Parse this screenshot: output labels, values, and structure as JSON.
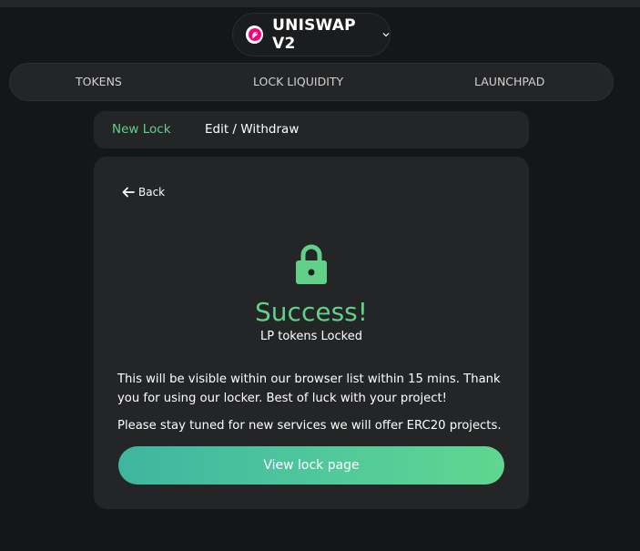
{
  "network": {
    "name": "UNISWAP V2",
    "icon": "uniswap-logo-icon",
    "dropdown_icon": "chevron-down-icon"
  },
  "main_tabs": [
    {
      "label": "TOKENS"
    },
    {
      "label": "LOCK LIQUIDITY"
    },
    {
      "label": "LAUNCHPAD"
    }
  ],
  "sub_tabs": [
    {
      "label": "New Lock",
      "active": true
    },
    {
      "label": "Edit / Withdraw",
      "active": false
    }
  ],
  "card": {
    "back_label": "Back",
    "status_icon": "lock-icon",
    "title": "Success!",
    "subtitle": "LP tokens Locked",
    "info_line_1": "This will be visible within our browser list within 15 mins. Thank you for using our locker. Best of luck with your project!",
    "info_line_2": "Please stay tuned for new services we will offer ERC20 projects.",
    "button_label": "View lock page"
  },
  "colors": {
    "accent_green": "#62d089",
    "background": "#151617",
    "panel": "#242527",
    "uniswap_pink": "#ff007a"
  }
}
